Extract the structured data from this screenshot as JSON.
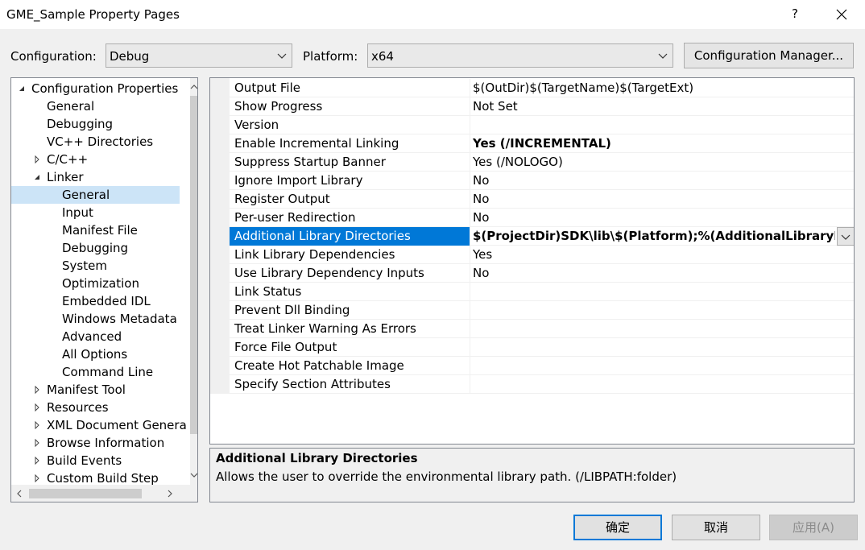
{
  "window": {
    "title": "GME_Sample Property Pages",
    "help_glyph": "?"
  },
  "config_row": {
    "configuration_label": "Configuration:",
    "configuration_value": "Debug",
    "platform_label": "Platform:",
    "platform_value": "x64",
    "config_manager_label": "Configuration Manager..."
  },
  "tree": {
    "items": [
      {
        "label": "Configuration Properties",
        "toggle": "expanded"
      },
      {
        "label": "General",
        "toggle": "none"
      },
      {
        "label": "Debugging",
        "toggle": "none"
      },
      {
        "label": "VC++ Directories",
        "toggle": "none"
      },
      {
        "label": "C/C++",
        "toggle": "collapsed"
      },
      {
        "label": "Linker",
        "toggle": "expanded"
      },
      {
        "label": "General",
        "toggle": "none",
        "selected": true
      },
      {
        "label": "Input",
        "toggle": "none"
      },
      {
        "label": "Manifest File",
        "toggle": "none"
      },
      {
        "label": "Debugging",
        "toggle": "none"
      },
      {
        "label": "System",
        "toggle": "none"
      },
      {
        "label": "Optimization",
        "toggle": "none"
      },
      {
        "label": "Embedded IDL",
        "toggle": "none"
      },
      {
        "label": "Windows Metadata",
        "toggle": "none"
      },
      {
        "label": "Advanced",
        "toggle": "none"
      },
      {
        "label": "All Options",
        "toggle": "none"
      },
      {
        "label": "Command Line",
        "toggle": "none"
      },
      {
        "label": "Manifest Tool",
        "toggle": "collapsed"
      },
      {
        "label": "Resources",
        "toggle": "collapsed"
      },
      {
        "label": "XML Document Genera",
        "toggle": "collapsed"
      },
      {
        "label": "Browse Information",
        "toggle": "collapsed"
      },
      {
        "label": "Build Events",
        "toggle": "collapsed"
      },
      {
        "label": "Custom Build Step",
        "toggle": "collapsed"
      }
    ]
  },
  "grid": {
    "rows": [
      {
        "name": "Output File",
        "value": "$(OutDir)$(TargetName)$(TargetExt)",
        "bold": false
      },
      {
        "name": "Show Progress",
        "value": "Not Set",
        "bold": false
      },
      {
        "name": "Version",
        "value": "",
        "bold": false
      },
      {
        "name": "Enable Incremental Linking",
        "value": "Yes (/INCREMENTAL)",
        "bold": true
      },
      {
        "name": "Suppress Startup Banner",
        "value": "Yes (/NOLOGO)",
        "bold": false
      },
      {
        "name": "Ignore Import Library",
        "value": "No",
        "bold": false
      },
      {
        "name": "Register Output",
        "value": "No",
        "bold": false
      },
      {
        "name": "Per-user Redirection",
        "value": "No",
        "bold": false
      },
      {
        "name": "Additional Library Directories",
        "value": "$(ProjectDir)SDK\\lib\\$(Platform);%(AdditionalLibraryDirectories)",
        "bold": true,
        "selected": true
      },
      {
        "name": "Link Library Dependencies",
        "value": "Yes",
        "bold": false
      },
      {
        "name": "Use Library Dependency Inputs",
        "value": "No",
        "bold": false
      },
      {
        "name": "Link Status",
        "value": "",
        "bold": false
      },
      {
        "name": "Prevent Dll Binding",
        "value": "",
        "bold": false
      },
      {
        "name": "Treat Linker Warning As Errors",
        "value": "",
        "bold": false
      },
      {
        "name": "Force File Output",
        "value": "",
        "bold": false
      },
      {
        "name": "Create Hot Patchable Image",
        "value": "",
        "bold": false
      },
      {
        "name": "Specify Section Attributes",
        "value": "",
        "bold": false
      }
    ]
  },
  "description": {
    "title": "Additional Library Directories",
    "text": "Allows the user to override the environmental library path. (/LIBPATH:folder)"
  },
  "buttons": {
    "ok": "确定",
    "cancel": "取消",
    "apply": "应用(A)"
  },
  "colors": {
    "selection_blue": "#0078d7",
    "tree_selection": "#cce4f7"
  }
}
